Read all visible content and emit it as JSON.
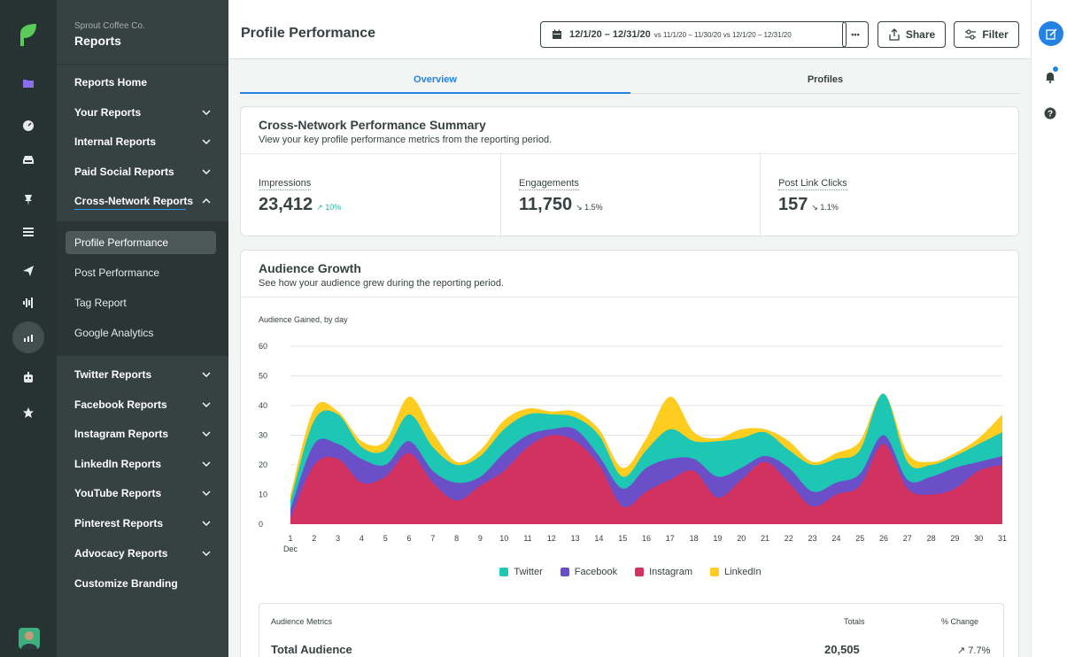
{
  "nav": {
    "org": "Sprout Coffee Co.",
    "title": "Reports",
    "items": [
      {
        "label": "Reports Home"
      },
      {
        "label": "Your Reports"
      },
      {
        "label": "Internal Reports"
      },
      {
        "label": "Paid Social Reports"
      },
      {
        "label": "Cross-Network Reports"
      }
    ],
    "sub_items": [
      {
        "label": "Profile Performance"
      },
      {
        "label": "Post Performance"
      },
      {
        "label": "Tag Report"
      },
      {
        "label": "Google Analytics"
      }
    ],
    "network_items": [
      {
        "label": "Twitter Reports"
      },
      {
        "label": "Facebook Reports"
      },
      {
        "label": "Instagram Reports"
      },
      {
        "label": "LinkedIn Reports"
      },
      {
        "label": "YouTube Reports"
      },
      {
        "label": "Pinterest Reports"
      },
      {
        "label": "Advocacy Reports"
      },
      {
        "label": "Customize Branding"
      }
    ]
  },
  "header": {
    "title": "Profile Performance",
    "date_range": "12/1/20 – 12/31/20",
    "date_compare": "vs 11/1/20 – 11/30/20 vs 12/1/20 – 12/31/20",
    "more_label": "•••",
    "share_label": "Share",
    "filter_label": "Filter"
  },
  "tabs": {
    "overview": "Overview",
    "profiles": "Profiles"
  },
  "summary": {
    "title": "Cross-Network Performance Summary",
    "subtitle": "View your key profile performance metrics from the reporting period.",
    "metrics": [
      {
        "label": "Impressions",
        "value": "23,412",
        "change": "↗ 10%"
      },
      {
        "label": "Engagements",
        "value": "11,750",
        "change": "↘ 1.5%"
      },
      {
        "label": "Post Link Clicks",
        "value": "157",
        "change": "↘ 1.1%"
      }
    ]
  },
  "growth": {
    "title": "Audience Growth",
    "subtitle": "See how your audience grew during the reporting period.",
    "chart_label": "Audience Gained, by day",
    "month_label": "Dec",
    "table": {
      "col_metric": "Audience Metrics",
      "col_totals": "Totals",
      "col_change": "% Change",
      "row_label": "Total Audience",
      "row_total": "20,505",
      "row_change": "↗ 7.7%"
    }
  },
  "colors": {
    "twitter": "#1ec7b3",
    "facebook": "#6a4fc8",
    "instagram": "#d2325f",
    "linkedin": "#ffcc20"
  },
  "chart_data": {
    "type": "area",
    "stacked": true,
    "x": [
      1,
      2,
      3,
      4,
      5,
      6,
      7,
      8,
      9,
      10,
      11,
      12,
      13,
      14,
      15,
      16,
      17,
      18,
      19,
      20,
      21,
      22,
      23,
      24,
      25,
      26,
      27,
      28,
      29,
      30,
      31
    ],
    "ylim": [
      0,
      60
    ],
    "yticks": [
      0,
      10,
      20,
      30,
      40,
      50,
      60
    ],
    "grid": true,
    "legend_position": "bottom",
    "series": [
      {
        "name": "Instagram",
        "values": [
          2,
          20,
          22,
          14,
          16,
          24,
          14,
          8,
          13,
          18,
          26,
          30,
          28,
          20,
          6,
          11,
          15,
          18,
          9,
          15,
          21,
          14,
          6,
          10,
          13,
          27,
          12,
          10,
          12,
          18,
          20
        ]
      },
      {
        "name": "Facebook",
        "values": [
          3,
          7,
          5,
          8,
          4,
          4,
          4,
          6,
          3,
          6,
          4,
          2,
          4,
          3,
          6,
          8,
          7,
          4,
          7,
          4,
          2,
          5,
          5,
          4,
          4,
          3,
          3,
          6,
          7,
          3,
          3
        ]
      },
      {
        "name": "Twitter",
        "values": [
          3,
          8,
          10,
          4,
          5,
          9,
          8,
          6,
          7,
          8,
          7,
          5,
          4,
          7,
          4,
          6,
          10,
          6,
          12,
          10,
          8,
          6,
          9,
          8,
          8,
          14,
          6,
          4,
          4,
          6,
          8
        ]
      },
      {
        "name": "LinkedIn",
        "values": [
          2,
          4,
          1,
          2,
          3,
          6,
          5,
          1,
          2,
          3,
          2,
          1,
          2,
          2,
          3,
          4,
          11,
          3,
          1,
          3,
          1,
          3,
          1,
          2,
          3,
          0,
          3,
          1,
          1,
          2,
          6
        ]
      }
    ],
    "xlabel": "Dec"
  }
}
